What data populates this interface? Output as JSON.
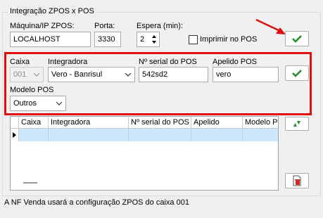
{
  "group_title": "Integração ZPOS x POS",
  "top": {
    "host_label": "Máquina/IP ZPOS:",
    "host_value": "LOCALHOST",
    "port_label": "Porta:",
    "port_value": "3330",
    "wait_label": "Espera (min):",
    "wait_value": "2",
    "print_label": "Imprimir no POS",
    "print_checked": false
  },
  "form": {
    "caixa_label": "Caixa",
    "caixa_value": "001",
    "integradora_label": "Integradora",
    "integradora_value": "Vero - Banrisul",
    "serial_label": "Nº serial do POS",
    "serial_value": "542sd2",
    "apelido_label": "Apelido POS",
    "apelido_value": "vero",
    "modelo_label": "Modelo POS",
    "modelo_value": "Outros"
  },
  "grid": {
    "columns": [
      "Caixa",
      "Integradora",
      "Nº serial do POS",
      "Apelido",
      "Modelo PC"
    ],
    "rows": [
      {
        "caixa": "",
        "integradora": "",
        "serial": "",
        "apelido": "",
        "modelo": ""
      }
    ]
  },
  "icons": {
    "confirm_top": "check-icon",
    "confirm_form": "check-icon",
    "sort": "up-down-arrows-icon",
    "delete": "trash-doc-icon",
    "annotation": "red-arrow-icon"
  },
  "colors": {
    "highlight_border": "#e01010",
    "check_green": "#1f8f2a",
    "selected_row": "#cce8ff"
  },
  "status_text": "A NF Venda usará a configuração ZPOS do caixa 001"
}
